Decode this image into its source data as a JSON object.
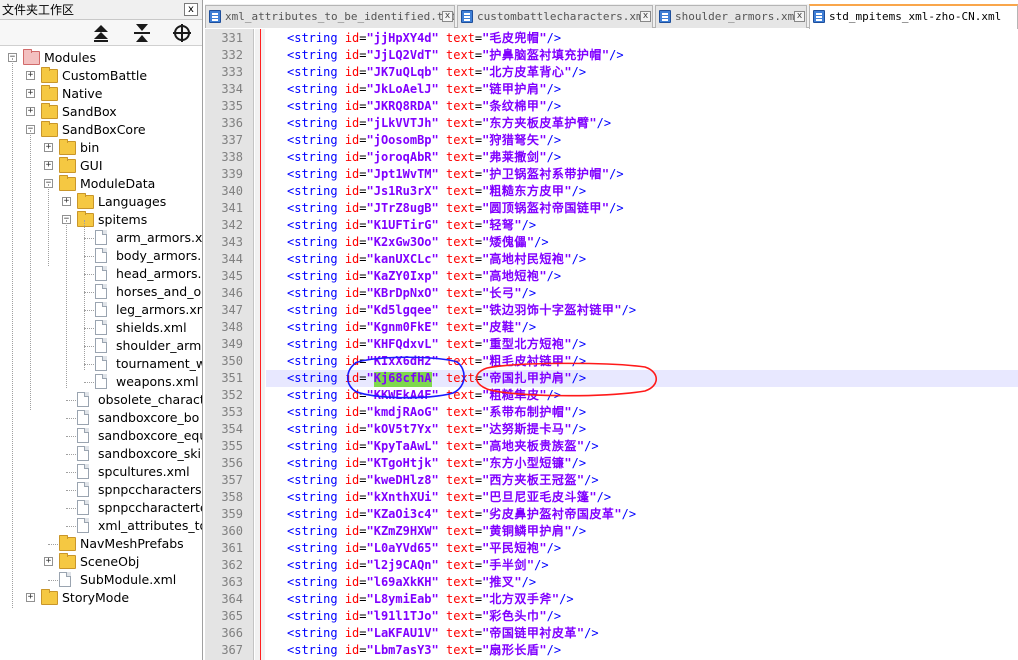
{
  "left_panel": {
    "title": "文件夹工作区",
    "close_glyph": "x",
    "toolbar": {
      "up_icon": "double-up-arrow-icon",
      "collapse_icon": "collapse-all-icon",
      "target_icon": "locate-target-icon"
    },
    "tree": [
      {
        "label": "Modules",
        "level": 0,
        "kind": "folder-red",
        "expander": "−"
      },
      {
        "label": "CustomBattle",
        "level": 1,
        "kind": "folder",
        "expander": "+"
      },
      {
        "label": "Native",
        "level": 1,
        "kind": "folder",
        "expander": "+"
      },
      {
        "label": "SandBox",
        "level": 1,
        "kind": "folder",
        "expander": "+"
      },
      {
        "label": "SandBoxCore",
        "level": 1,
        "kind": "folder",
        "expander": "−"
      },
      {
        "label": "bin",
        "level": 2,
        "kind": "folder",
        "expander": "+"
      },
      {
        "label": "GUI",
        "level": 2,
        "kind": "folder",
        "expander": "+"
      },
      {
        "label": "ModuleData",
        "level": 2,
        "kind": "folder",
        "expander": "−"
      },
      {
        "label": "Languages",
        "level": 3,
        "kind": "folder",
        "expander": "+"
      },
      {
        "label": "spitems",
        "level": 3,
        "kind": "folder",
        "expander": "−"
      },
      {
        "label": "arm_armors.x",
        "level": 4,
        "kind": "file",
        "expander": ""
      },
      {
        "label": "body_armors.",
        "level": 4,
        "kind": "file",
        "expander": ""
      },
      {
        "label": "head_armors.",
        "level": 4,
        "kind": "file",
        "expander": ""
      },
      {
        "label": "horses_and_o",
        "level": 4,
        "kind": "file",
        "expander": ""
      },
      {
        "label": "leg_armors.xn",
        "level": 4,
        "kind": "file",
        "expander": ""
      },
      {
        "label": "shields.xml",
        "level": 4,
        "kind": "file",
        "expander": ""
      },
      {
        "label": "shoulder_arm",
        "level": 4,
        "kind": "file",
        "expander": ""
      },
      {
        "label": "tournament_w",
        "level": 4,
        "kind": "file",
        "expander": ""
      },
      {
        "label": "weapons.xml",
        "level": 4,
        "kind": "file",
        "expander": ""
      },
      {
        "label": "obsolete_charact",
        "level": 3,
        "kind": "file",
        "expander": ""
      },
      {
        "label": "sandboxcore_bo",
        "level": 3,
        "kind": "file",
        "expander": ""
      },
      {
        "label": "sandboxcore_equ",
        "level": 3,
        "kind": "file",
        "expander": ""
      },
      {
        "label": "sandboxcore_ski",
        "level": 3,
        "kind": "file",
        "expander": ""
      },
      {
        "label": "spcultures.xml",
        "level": 3,
        "kind": "file",
        "expander": ""
      },
      {
        "label": "spnpccharacters.",
        "level": 3,
        "kind": "file",
        "expander": ""
      },
      {
        "label": "spnpccharacterte",
        "level": 3,
        "kind": "file",
        "expander": ""
      },
      {
        "label": "xml_attributes_to",
        "level": 3,
        "kind": "file",
        "expander": ""
      },
      {
        "label": "NavMeshPrefabs",
        "level": 2,
        "kind": "folder",
        "expander": ""
      },
      {
        "label": "SceneObj",
        "level": 2,
        "kind": "folder",
        "expander": "+"
      },
      {
        "label": "SubModule.xml",
        "level": 2,
        "kind": "file",
        "expander": ""
      },
      {
        "label": "StoryMode",
        "level": 1,
        "kind": "folder",
        "expander": "+"
      }
    ]
  },
  "tabs": [
    {
      "label": "xml_attributes_to_be_identified.txt",
      "active": false,
      "icon": "file-icon"
    },
    {
      "label": "custombattlecharacters.xml",
      "active": false,
      "icon": "file-icon"
    },
    {
      "label": "shoulder_armors.xml",
      "active": false,
      "icon": "file-icon"
    },
    {
      "label": "std_mpitems_xml-zho-CN.xml",
      "active": true,
      "icon": "file-icon"
    }
  ],
  "tab_close_glyph": "x",
  "editor": {
    "syntax": {
      "tag_open": "<string",
      "attr_id": "id",
      "attr_text": "text",
      "tag_close": "/>"
    },
    "current_line": 351,
    "lines": [
      {
        "n": "331",
        "id": "jjHpXY4d",
        "text": "毛皮兜帽"
      },
      {
        "n": "332",
        "id": "JjLQ2VdT",
        "text": "护鼻脑盔衬填充护帽"
      },
      {
        "n": "333",
        "id": "JK7uQLqb",
        "text": "北方皮革背心"
      },
      {
        "n": "334",
        "id": "JkLoAelJ",
        "text": "链甲护肩"
      },
      {
        "n": "335",
        "id": "JKRQ8RDA",
        "text": "条纹棉甲"
      },
      {
        "n": "336",
        "id": "jLkVVTJh",
        "text": "东方夹板皮革护臂"
      },
      {
        "n": "337",
        "id": "jOosomBp",
        "text": "狩猎弩矢"
      },
      {
        "n": "338",
        "id": "joroqAbR",
        "text": "弗莱撒剑"
      },
      {
        "n": "339",
        "id": "Jpt1WvTM",
        "text": "护卫锅盔衬系带护帽"
      },
      {
        "n": "340",
        "id": "Js1Ru3rX",
        "text": "粗糙东方皮甲"
      },
      {
        "n": "341",
        "id": "JTrZ8ugB",
        "text": "圆顶锅盔衬帝国链甲"
      },
      {
        "n": "342",
        "id": "K1UFTirG",
        "text": "轻弩"
      },
      {
        "n": "343",
        "id": "K2xGw3Oo",
        "text": "矮傀儡"
      },
      {
        "n": "344",
        "id": "kanUXCLc",
        "text": "高地村民短袍"
      },
      {
        "n": "345",
        "id": "KaZY0Ixp",
        "text": "高地短袍"
      },
      {
        "n": "346",
        "id": "KBrDpNxO",
        "text": "长弓"
      },
      {
        "n": "347",
        "id": "Kd5lgqee",
        "text": "铁边羽饰十字盔衬链甲"
      },
      {
        "n": "348",
        "id": "Kgnm0FkE",
        "text": "皮鞋"
      },
      {
        "n": "349",
        "id": "KHFQdxvL",
        "text": "重型北方短袍"
      },
      {
        "n": "350",
        "id": "KIxX6dH2",
        "text": "粗毛皮衬链甲"
      },
      {
        "n": "351",
        "id": "Kj68cfhA",
        "text": "帝国扎甲护肩"
      },
      {
        "n": "352",
        "id": "KKWEkA4F",
        "text": "粗糙隼皮"
      },
      {
        "n": "353",
        "id": "kmdjRAoG",
        "text": "系带布制护帽"
      },
      {
        "n": "354",
        "id": "kOV5t7Yx",
        "text": "达努斯提卡马"
      },
      {
        "n": "355",
        "id": "KpyTaAwL",
        "text": "高地夹板贵族盔"
      },
      {
        "n": "356",
        "id": "KTgoHtjk",
        "text": "东方小型短镰"
      },
      {
        "n": "357",
        "id": "kweDHlz8",
        "text": "西方夹板王冠盔"
      },
      {
        "n": "358",
        "id": "kXnthXUi",
        "text": "巴旦尼亚毛皮斗篷"
      },
      {
        "n": "359",
        "id": "KZaOi3c4",
        "text": "劣皮鼻护盔衬帝国皮革"
      },
      {
        "n": "360",
        "id": "KZmZ9HXW",
        "text": "黄铜鳞甲护肩"
      },
      {
        "n": "361",
        "id": "L0aYVd65",
        "text": "平民短袍"
      },
      {
        "n": "362",
        "id": "l2j9CAQn",
        "text": "手半剑"
      },
      {
        "n": "363",
        "id": "l69aXkKH",
        "text": "推叉"
      },
      {
        "n": "364",
        "id": "L8ymiEab",
        "text": "北方双手斧"
      },
      {
        "n": "365",
        "id": "l91l1TJo",
        "text": "彩色头巾"
      },
      {
        "n": "366",
        "id": "LaKFAU1V",
        "text": "帝国链甲衬皮革"
      },
      {
        "n": "367",
        "id": "Lbm7asY3",
        "text": "扇形长盾"
      }
    ]
  },
  "colors": {
    "tag": "#0000ff",
    "attribute": "#ff0000",
    "value": "#8000ff",
    "current_line_bg": "#e8e8ff",
    "id_highlight": "#7fd84e",
    "annotation_blue": "#1a1aff",
    "annotation_red": "#ff1a1a",
    "active_tab_accent": "#f9a64b"
  }
}
